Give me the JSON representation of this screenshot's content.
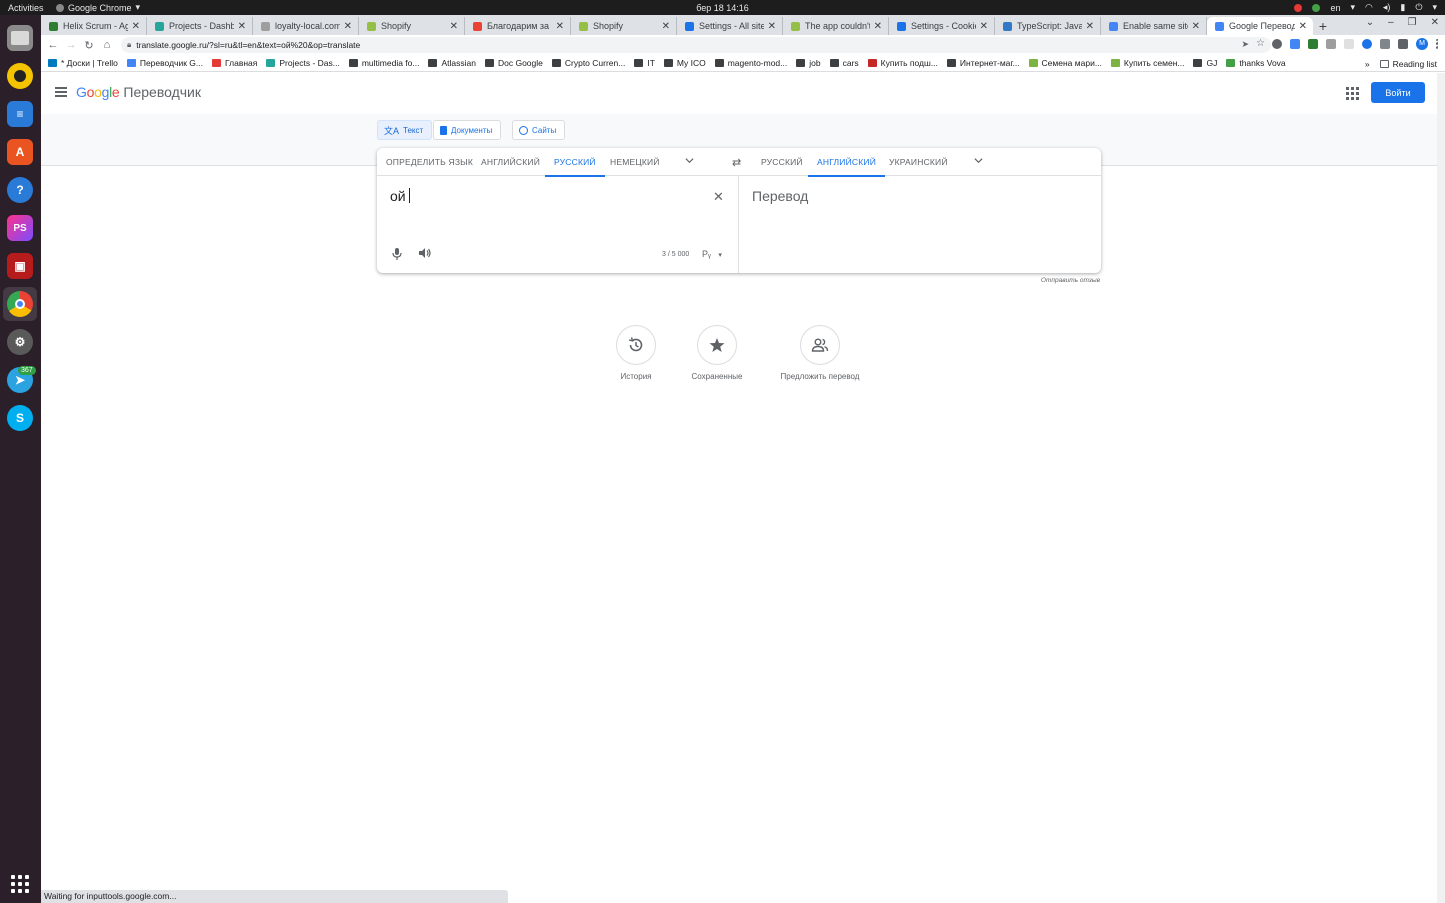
{
  "os_bar": {
    "activities": "Activities",
    "app_name": "Google Chrome",
    "clock": "бер 18  14:16",
    "lang": "en"
  },
  "dock": {
    "badge_count": "367"
  },
  "tabs": [
    {
      "title": "Helix Scrum - Agil",
      "color": "#2e7d32"
    },
    {
      "title": "Projects - Dashbo",
      "color": "#26a69a"
    },
    {
      "title": "loyalty-local.com",
      "color": "#9e9e9e"
    },
    {
      "title": "Shopify",
      "color": "#95bf47"
    },
    {
      "title": "Благодарим за пс",
      "color": "#ea4335"
    },
    {
      "title": "Shopify",
      "color": "#95bf47"
    },
    {
      "title": "Settings - All sites",
      "color": "#1a73e8"
    },
    {
      "title": "The app couldn't b",
      "color": "#95bf47"
    },
    {
      "title": "Settings - Cookies",
      "color": "#1a73e8"
    },
    {
      "title": "TypeScript: JavaS",
      "color": "#3178c6"
    },
    {
      "title": "Enable same site",
      "color": "#4285f4"
    },
    {
      "title": "Google Переводч",
      "color": "#4285f4"
    }
  ],
  "address": {
    "url": "translate.google.ru/?sl=ru&tl=en&text=ой%20&op=translate"
  },
  "bookmarks": {
    "items": [
      {
        "label": "* Доски | Trello",
        "color": "#0079bf"
      },
      {
        "label": "Переводчик G...",
        "color": "#4285f4"
      },
      {
        "label": "Главная",
        "color": "#e53935"
      },
      {
        "label": "Projects - Das...",
        "color": "#26a69a"
      },
      {
        "label": "multimedia fo...",
        "color": "#3c4043"
      },
      {
        "label": "Atlassian",
        "color": "#3c4043"
      },
      {
        "label": "Doc Google",
        "color": "#3c4043"
      },
      {
        "label": "Crypto Curren...",
        "color": "#3c4043"
      },
      {
        "label": "IT",
        "color": "#3c4043"
      },
      {
        "label": "My ICO",
        "color": "#3c4043"
      },
      {
        "label": "magento-mod...",
        "color": "#3c4043"
      },
      {
        "label": "job",
        "color": "#3c4043"
      },
      {
        "label": "cars",
        "color": "#3c4043"
      },
      {
        "label": "Купить подш...",
        "color": "#c62828"
      },
      {
        "label": "Интернет-маг...",
        "color": "#3c4043"
      },
      {
        "label": "Семена мари...",
        "color": "#7cb342"
      },
      {
        "label": "Купить семен...",
        "color": "#7cb342"
      },
      {
        "label": "GJ",
        "color": "#3c4043"
      },
      {
        "label": "thanks Vova",
        "color": "#43a047"
      }
    ],
    "more": "»",
    "reading_list": "Reading list"
  },
  "translate": {
    "logo_google": "Google",
    "logo_product": "Переводчик",
    "signin": "Войти",
    "modes": [
      "Текст",
      "Документы",
      "Сайты"
    ],
    "source_langs": [
      "Определить язык",
      "Английский",
      "Русский",
      "Немецкий"
    ],
    "target_langs": [
      "Русский",
      "Английский",
      "Украинский"
    ],
    "source_text": "ой",
    "target_placeholder": "Перевод",
    "char_count": "3 / 5 000",
    "translit": "Рᵧ",
    "feedback": "Отправить отзыв",
    "actions": [
      "История",
      "Сохраненные",
      "Предложить перевод"
    ]
  },
  "status": "Waiting for inputtools.google.com..."
}
